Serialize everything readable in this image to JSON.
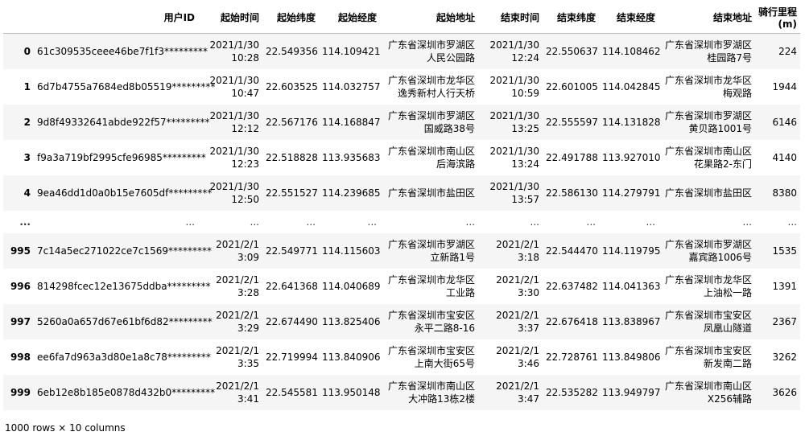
{
  "columns": {
    "index": "",
    "user_id": "用户ID",
    "start_time": "起始时间",
    "start_lat": "起始纬度",
    "start_lon": "起始经度",
    "start_addr": "起始地址",
    "end_time": "结束时间",
    "end_lat": "结束纬度",
    "end_lon": "结束经度",
    "end_addr": "结束地址",
    "distance": "骑行里程(m)"
  },
  "rows": [
    {
      "index": "0",
      "user_id": "61c309535ceee46be7f1f3*********",
      "start_time": "2021/1/30 10:28",
      "start_lat": "22.549356",
      "start_lon": "114.109421",
      "start_addr": "广东省深圳市罗湖区人民公园路",
      "end_time": "2021/1/30 12:24",
      "end_lat": "22.550637",
      "end_lon": "114.108462",
      "end_addr": "广东省深圳市罗湖区桂园路7号",
      "distance": "224"
    },
    {
      "index": "1",
      "user_id": "6d7b4755a7684ed8b05519*********",
      "start_time": "2021/1/30 10:47",
      "start_lat": "22.603525",
      "start_lon": "114.032757",
      "start_addr": "广东省深圳市龙华区逸秀新村人行天桥",
      "end_time": "2021/1/30 10:59",
      "end_lat": "22.601005",
      "end_lon": "114.042845",
      "end_addr": "广东省深圳市龙华区梅观路",
      "distance": "1944"
    },
    {
      "index": "2",
      "user_id": "9d8f49332641abde922f57*********",
      "start_time": "2021/1/30 12:12",
      "start_lat": "22.567176",
      "start_lon": "114.168847",
      "start_addr": "广东省深圳市罗湖区国威路38号",
      "end_time": "2021/1/30 13:25",
      "end_lat": "22.555597",
      "end_lon": "114.131828",
      "end_addr": "广东省深圳市罗湖区黄贝路1001号",
      "distance": "6146"
    },
    {
      "index": "3",
      "user_id": "f9a3a719bf2995cfe96985*********",
      "start_time": "2021/1/30 12:23",
      "start_lat": "22.518828",
      "start_lon": "113.935683",
      "start_addr": "广东省深圳市南山区后海滨路",
      "end_time": "2021/1/30 13:24",
      "end_lat": "22.491788",
      "end_lon": "113.927010",
      "end_addr": "广东省深圳市南山区花果路2-东门",
      "distance": "4140"
    },
    {
      "index": "4",
      "user_id": "9ea46dd1d0a0b15e7605df*********",
      "start_time": "2021/1/30 12:50",
      "start_lat": "22.551527",
      "start_lon": "114.239685",
      "start_addr": "广东省深圳市盐田区",
      "end_time": "2021/1/30 13:57",
      "end_lat": "22.586130",
      "end_lon": "114.279791",
      "end_addr": "广东省深圳市盐田区",
      "distance": "8380"
    },
    {
      "index": "...",
      "user_id": "...",
      "start_time": "...",
      "start_lat": "...",
      "start_lon": "...",
      "start_addr": "...",
      "end_time": "...",
      "end_lat": "...",
      "end_lon": "...",
      "end_addr": "...",
      "distance": "...",
      "ellipsis": true
    },
    {
      "index": "995",
      "user_id": "7c14a5ec271022ce7c1569*********",
      "start_time": "2021/2/1 3:09",
      "start_lat": "22.549771",
      "start_lon": "114.115603",
      "start_addr": "广东省深圳市罗湖区立新路1号",
      "end_time": "2021/2/1 3:18",
      "end_lat": "22.544470",
      "end_lon": "114.119795",
      "end_addr": "广东省深圳市罗湖区嘉宾路1006号",
      "distance": "1535"
    },
    {
      "index": "996",
      "user_id": "814298fcec12e13675ddba*********",
      "start_time": "2021/2/1 3:28",
      "start_lat": "22.641368",
      "start_lon": "114.040689",
      "start_addr": "广东省深圳市龙华区工业路",
      "end_time": "2021/2/1 3:30",
      "end_lat": "22.637482",
      "end_lon": "114.041363",
      "end_addr": "广东省深圳市龙华区上油松一路",
      "distance": "1391"
    },
    {
      "index": "997",
      "user_id": "5260a0a657d67e61bf6d82*********",
      "start_time": "2021/2/1 3:29",
      "start_lat": "22.674490",
      "start_lon": "113.825406",
      "start_addr": "广东省深圳市宝安区永平二路8-16",
      "end_time": "2021/2/1 3:37",
      "end_lat": "22.676418",
      "end_lon": "113.838967",
      "end_addr": "广东省深圳市宝安区凤凰山隧道",
      "distance": "2367"
    },
    {
      "index": "998",
      "user_id": "ee6fa7d963a3d80e1a8c78*********",
      "start_time": "2021/2/1 3:35",
      "start_lat": "22.719994",
      "start_lon": "113.840906",
      "start_addr": "广东省深圳市宝安区上南大街65号",
      "end_time": "2021/2/1 3:46",
      "end_lat": "22.728761",
      "end_lon": "113.849806",
      "end_addr": "广东省深圳市宝安区新发南二路",
      "distance": "3262"
    },
    {
      "index": "999",
      "user_id": "6eb12e8b185e0878d432b0*********",
      "start_time": "2021/2/1 3:41",
      "start_lat": "22.545581",
      "start_lon": "113.950148",
      "start_addr": "广东省深圳市南山区大冲路13栋2楼",
      "end_time": "2021/2/1 3:47",
      "end_lat": "22.535282",
      "end_lon": "113.949797",
      "end_addr": "广东省深圳市南山区X256辅路",
      "distance": "3626"
    }
  ],
  "footer": "1000 rows × 10 columns"
}
